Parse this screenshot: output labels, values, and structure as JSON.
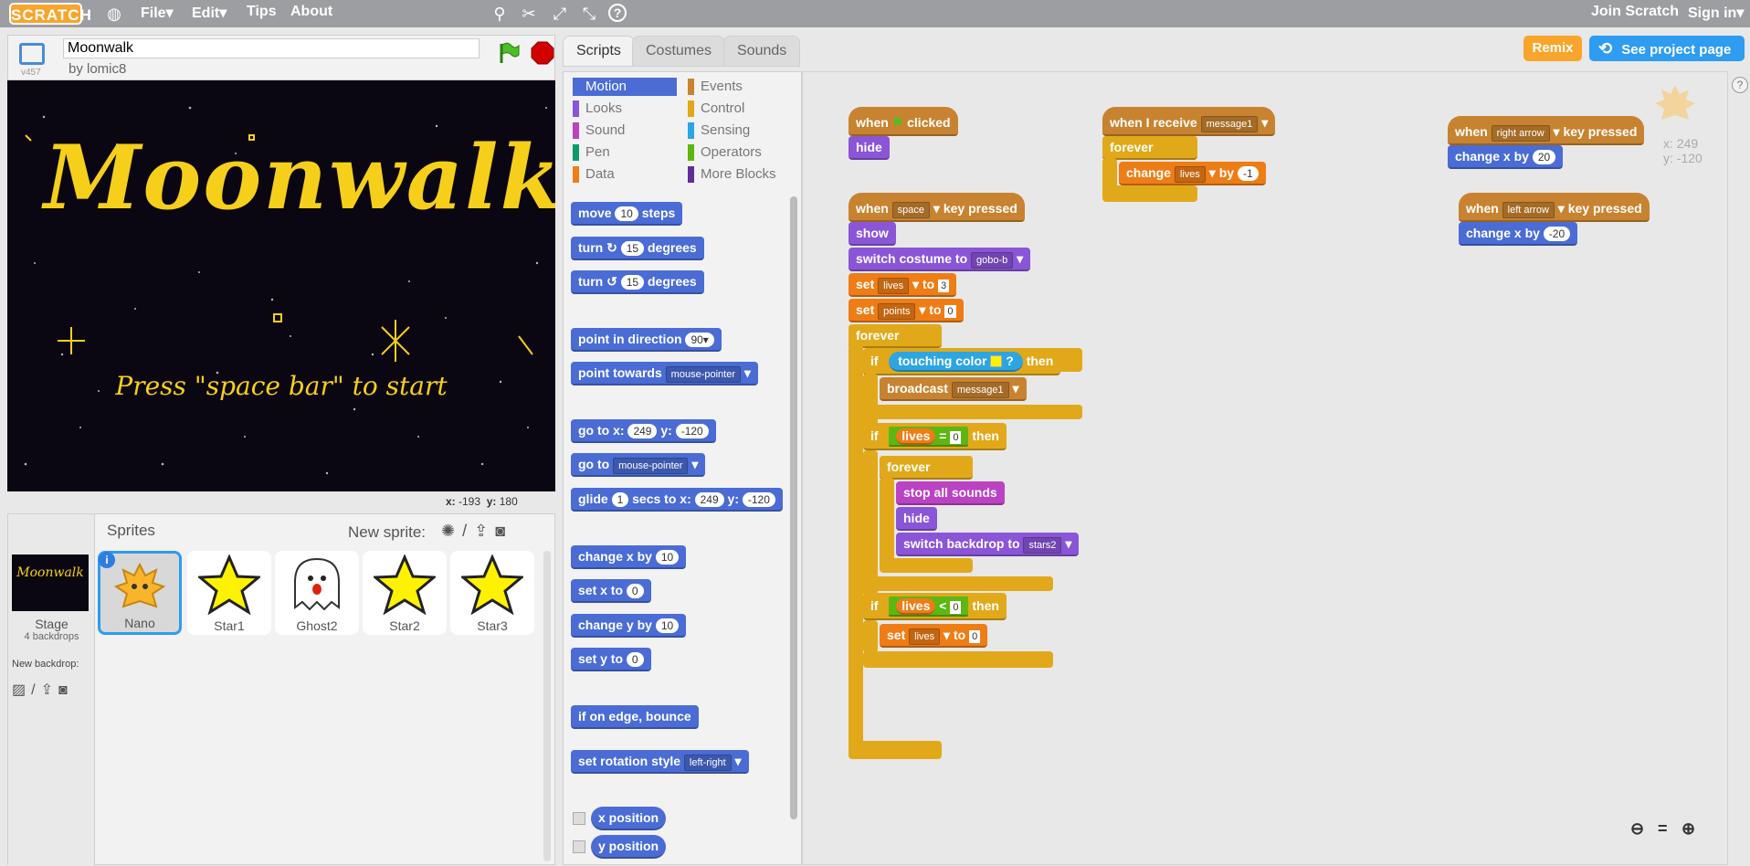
{
  "menubar": {
    "logo": "SCRATCH",
    "file": "File▾",
    "edit": "Edit▾",
    "tips": "Tips",
    "about": "About",
    "join": "Join Scratch",
    "signin": "Sign in▾"
  },
  "project": {
    "title": "Moonwalk",
    "author": "by lomic8",
    "version": "v457"
  },
  "stage": {
    "title_art": "Moonwalk",
    "press": "Press \"space bar\" to start",
    "x_label": "x:",
    "x_val": "-193",
    "y_label": "y:",
    "y_val": "180"
  },
  "sprites": {
    "header": "Sprites",
    "new_sprite": "New sprite:",
    "stage_label": "Stage",
    "backdrops": "4 backdrops",
    "new_backdrop": "New backdrop:",
    "items": [
      "Nano",
      "Star1",
      "Ghost2",
      "Star2",
      "Star3"
    ]
  },
  "tabs": [
    "Scripts",
    "Costumes",
    "Sounds"
  ],
  "top_buttons": {
    "remix": "Remix",
    "see_project": "See project page"
  },
  "categories": {
    "left": [
      "Motion",
      "Looks",
      "Sound",
      "Pen",
      "Data"
    ],
    "right": [
      "Events",
      "Control",
      "Sensing",
      "Operators",
      "More Blocks"
    ]
  },
  "palette": {
    "move": "move",
    "move_n": "10",
    "steps": "steps",
    "turn": "turn",
    "turn_n": "15",
    "degrees": "degrees",
    "point_dir": "point in direction",
    "point_dir_n": "90▾",
    "point_towards": "point towards",
    "mouse_pointer": "mouse-pointer",
    "goto_x": "go to x:",
    "goto_x_n": "249",
    "goto_y": "y:",
    "goto_y_n": "-120",
    "goto": "go to",
    "glide": "glide",
    "glide_n": "1",
    "glide_secs": "secs to x:",
    "glide_x": "249",
    "glide_y_lbl": "y:",
    "glide_y": "-120",
    "change_x": "change x by",
    "change_x_n": "10",
    "set_x": "set x to",
    "set_x_n": "0",
    "change_y": "change y by",
    "change_y_n": "10",
    "set_y": "set y to",
    "set_y_n": "0",
    "bounce": "if on edge, bounce",
    "rotation": "set rotation style",
    "rotation_v": "left-right",
    "xpos": "x position",
    "ypos": "y position"
  },
  "scripts": {
    "when": "when",
    "clicked": "clicked",
    "hide": "hide",
    "space": "space",
    "key_pressed": "key pressed",
    "show": "show",
    "switch_costume": "switch costume to",
    "gobo": "gobo-b",
    "set": "set",
    "lives": "lives",
    "to": "to",
    "three": "3",
    "points": "points",
    "zero": "0",
    "forever": "forever",
    "if": "if",
    "touching_color": "touching color",
    "q": "?",
    "then": "then",
    "broadcast": "broadcast",
    "message1": "message1",
    "eq": "=",
    "lt": "<",
    "stop_all": "stop all sounds",
    "switch_backdrop": "switch backdrop to",
    "stars2": "stars2",
    "when_receive": "when I receive",
    "change": "change",
    "by": "by",
    "minus1": "-1",
    "right_arrow": "right arrow",
    "left_arrow": "left arrow",
    "change_x": "change x by",
    "twenty": "20",
    "minus20": "-20",
    "sprite_x": "x: 249",
    "sprite_y": "y: -120"
  }
}
